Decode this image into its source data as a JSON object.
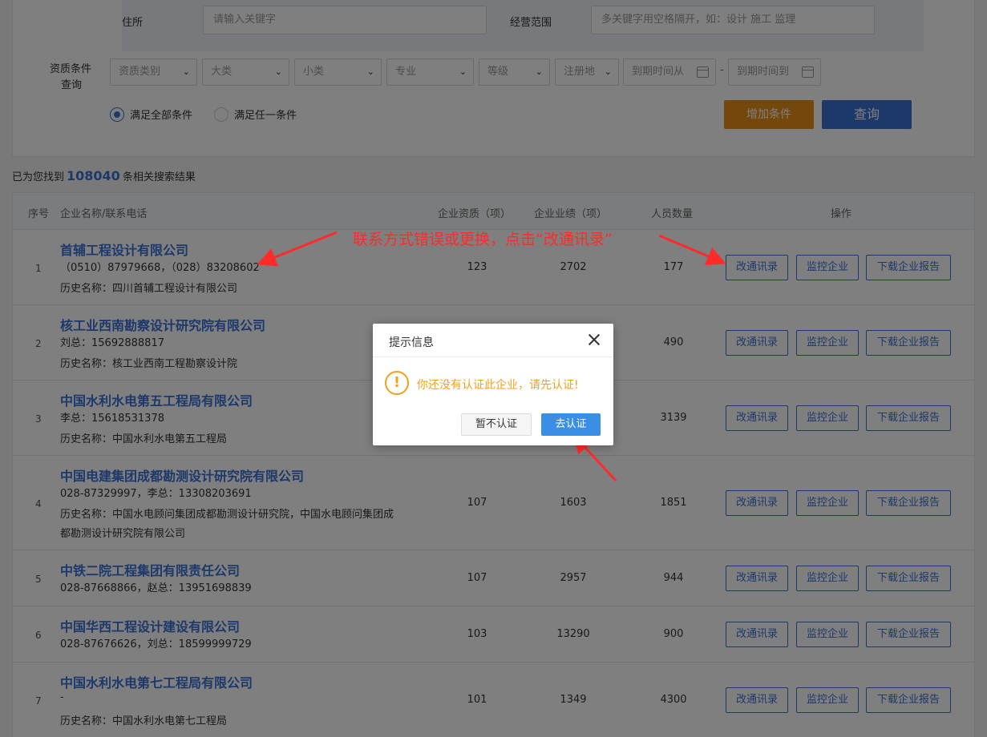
{
  "filter": {
    "address_label": "住所",
    "address_placeholder": "请输入关键字",
    "scope_label": "经营范围",
    "scope_placeholder": "多关键字用空格隔开，如：设计 施工 监理",
    "qual_label_1": "资质条件",
    "qual_label_2": "查询",
    "selects": [
      "资质类别",
      "大类",
      "小类",
      "专业",
      "等级",
      "注册地"
    ],
    "date_from": "到期时间从",
    "date_to": "到期时间到",
    "date_sep": "-",
    "radio_all": "满足全部条件",
    "radio_any": "满足任一条件",
    "add_button": "增加条件",
    "query_button": "查询"
  },
  "results": {
    "prefix": "已为您找到",
    "count": "108040",
    "suffix": "条相关搜索结果"
  },
  "table": {
    "headers": {
      "index": "序号",
      "name": "企业名称/联系电话",
      "qualifications": "企业资质（项）",
      "performance": "企业业绩（项）",
      "staff": "人员数量",
      "actions": "操作"
    },
    "buttons": {
      "edit": "改通讯录",
      "monitor": "监控企业",
      "report": "下载企业报告"
    },
    "rows": [
      {
        "index": "1",
        "name": "首辅工程设计有限公司",
        "phone": "（0510）87979668，（028）83208602",
        "history": "历史名称：四川首辅工程设计有限公司",
        "history2": "",
        "qualifications": "123",
        "performance": "2702",
        "staff": "177"
      },
      {
        "index": "2",
        "name": "核工业西南勘察设计研究院有限公司",
        "phone": "刘总：15692888817",
        "history": "历史名称：核工业西南工程勘察设计院",
        "history2": "",
        "qualifications": "",
        "performance": "",
        "staff": "490"
      },
      {
        "index": "3",
        "name": "中国水利水电第五工程局有限公司",
        "phone": "李总：15618531378",
        "history": "历史名称：中国水利水电第五工程局",
        "history2": "",
        "qualifications": "",
        "performance": "",
        "staff": "3139"
      },
      {
        "index": "4",
        "name": "中国电建集团成都勘测设计研究院有限公司",
        "phone": "028-87329997，李总：13308203691",
        "history": "历史名称：中国水电顾问集团成都勘测设计研究院，中国水电顾问集团成",
        "history2": "都勘测设计研究院有限公司",
        "qualifications": "107",
        "performance": "1603",
        "staff": "1851"
      },
      {
        "index": "5",
        "name": "中铁二院工程集团有限责任公司",
        "phone": "028-87668866，赵总：13951698839",
        "history": "",
        "history2": "",
        "qualifications": "107",
        "performance": "2957",
        "staff": "944"
      },
      {
        "index": "6",
        "name": "中国华西工程设计建设有限公司",
        "phone": "028-87676626，刘总：18599999729",
        "history": "",
        "history2": "",
        "qualifications": "103",
        "performance": "13290",
        "staff": "900"
      },
      {
        "index": "7",
        "name": "中国水利水电第七工程局有限公司",
        "phone": "-",
        "history": "历史名称：中国水利水电第七工程局",
        "history2": "",
        "qualifications": "101",
        "performance": "1349",
        "staff": "4300"
      }
    ]
  },
  "annotation": {
    "text": "联系方式错误或更换，点击“改通讯录”",
    "color": "#ff2a2a"
  },
  "dialog": {
    "title": "提示信息",
    "message": "你还没有认证此企业，请先认证!",
    "icon_symbol": "!",
    "cancel_button": "暂不认证",
    "confirm_button": "去认证"
  }
}
